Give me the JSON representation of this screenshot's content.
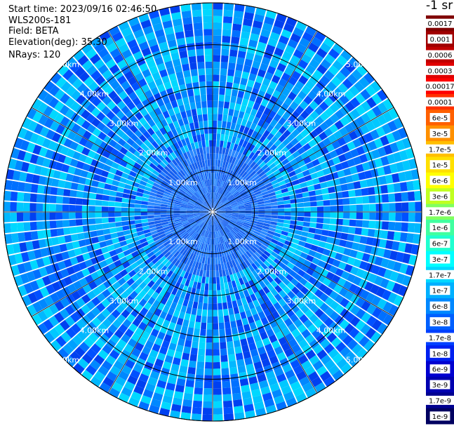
{
  "header": {
    "start_time": "Start time: 2023/09/16 02:46:50",
    "instrument": "WLS200s-181",
    "field": "Field: BETA",
    "elevation": "Elevation(deg): 35.30",
    "nrays": "NRays: 120"
  },
  "colorbar": {
    "unit": "-1 sr",
    "labels": [
      "0.0017",
      "0.001",
      "0.0006",
      "0.0003",
      "0.00017",
      "0.0001",
      "6e-5",
      "3e-5",
      "1.7e-5",
      "1e-5",
      "6e-6",
      "3e-6",
      "1.7e-6",
      "1e-6",
      "6e-7",
      "3e-7",
      "1.7e-7",
      "1e-7",
      "6e-8",
      "3e-8",
      "1.7e-8",
      "1e-8",
      "6e-9",
      "3e-9",
      "1.7e-9",
      "1e-9"
    ],
    "colors": [
      "#800000",
      "#a00000",
      "#c00000",
      "#e00000",
      "#ff0000",
      "#ff3000",
      "#ff6000",
      "#ff9000",
      "#ffbf00",
      "#ffe000",
      "#ffff00",
      "#c0ff20",
      "#80ff60",
      "#40ffa0",
      "#20ffd0",
      "#00ffff",
      "#00d8ff",
      "#00b0ff",
      "#0088ff",
      "#0060ff",
      "#0040ff",
      "#0020f0",
      "#0000d0",
      "#0000b0",
      "#000090",
      "#000060"
    ]
  },
  "chart_data": {
    "type": "ppi",
    "field": "BETA",
    "elevation_deg": 35.3,
    "nrays": 120,
    "range_rings_km": [
      1,
      2,
      3,
      4,
      5
    ],
    "max_range_km": 5.0,
    "ring_labels": [
      "1.00km",
      "2.00km",
      "3.00km",
      "4.00km",
      "5.00km"
    ],
    "radial_lines_deg": [
      0,
      30,
      60,
      90,
      120,
      150,
      180,
      210,
      240,
      270,
      300,
      330
    ],
    "colorscale": "log",
    "value_range": [
      1e-09,
      0.0017
    ],
    "typical_value_near": 3e-08,
    "typical_value_far": 1.7e-08
  }
}
